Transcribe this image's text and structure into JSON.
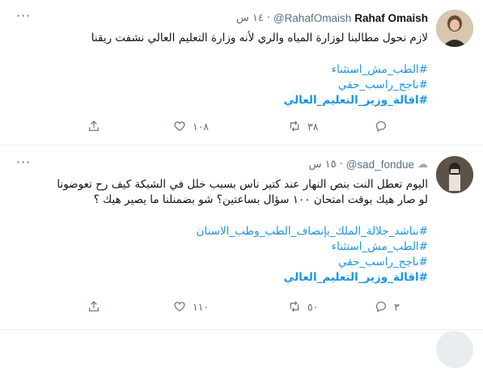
{
  "tweets": [
    {
      "name": "Rahaf Omaish",
      "handle": "@RahafOmaish",
      "dot": "·",
      "time": "١٤ س",
      "text": "لازم نحول مطالبنا لوزارة المياه والري لأنه وزارة التعليم العالي نشفت ريقنا",
      "hashtags": [
        "#الطب_مش_استثناء",
        "#ناجح_راسب_حقي",
        "#اقالة_وزير_التعليم_العالي"
      ],
      "bold_hashtag_index": 2,
      "replies": "",
      "retweets": "٣٨",
      "likes": "١٠٨",
      "share": ""
    },
    {
      "name": "",
      "handle": "@sad_fondue",
      "dot": "·",
      "time": "١٥ س",
      "emoji_name": "cloud-emoji-icon",
      "text_lines": [
        "اليوم تعطل النت بنص النهار عند كتير ناس بسبب خلل في الشبكة كيف رح تعوضونا",
        "لو صار هيك بوقت امتحان ١٠٠ سؤال بساعتين؟ شو بضمنلنا ما يصير هيك ؟"
      ],
      "hashtags": [
        "#نناشد_جلالة_الملك_بإنصاف_الطب_وطب_الاسنان",
        "#الطب_مش_استثناء",
        "#ناجح_راسب_حقي",
        "#اقالة_وزير_التعليم_العالي"
      ],
      "bold_hashtag_index": 3,
      "replies": "٣",
      "retweets": "٥٠",
      "likes": "١١٠",
      "share": ""
    }
  ],
  "colors": {
    "link": "#1b95e0",
    "muted": "#5b7083",
    "text": "#0f1419",
    "border": "#ebeef0"
  },
  "icons": [
    "more-icon",
    "reply-icon",
    "retweet-icon",
    "like-icon",
    "share-icon"
  ]
}
